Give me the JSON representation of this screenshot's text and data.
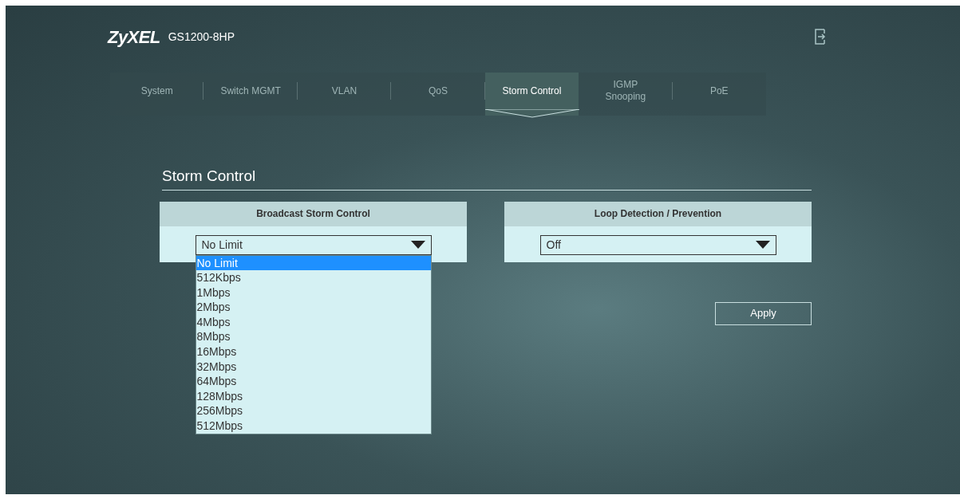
{
  "header": {
    "brand": "ZyXEL",
    "model": "GS1200-8HP"
  },
  "tabs": [
    {
      "label": "System",
      "selected": false
    },
    {
      "label": "Switch MGMT",
      "selected": false
    },
    {
      "label": "VLAN",
      "selected": false
    },
    {
      "label": "QoS",
      "selected": false
    },
    {
      "label": "Storm Control",
      "selected": true
    },
    {
      "label": "IGMP Snooping",
      "selected": false
    },
    {
      "label": "PoE",
      "selected": false
    }
  ],
  "section_title": "Storm Control",
  "panels": [
    {
      "header": "Broadcast Storm Control",
      "value": "No Limit",
      "options": [
        {
          "label": "No Limit",
          "selected": true
        },
        {
          "label": "512Kbps",
          "selected": false
        },
        {
          "label": "1Mbps",
          "selected": false
        },
        {
          "label": "2Mbps",
          "selected": false
        },
        {
          "label": "4Mbps",
          "selected": false
        },
        {
          "label": "8Mbps",
          "selected": false
        },
        {
          "label": "16Mbps",
          "selected": false
        },
        {
          "label": "32Mbps",
          "selected": false
        },
        {
          "label": "64Mbps",
          "selected": false
        },
        {
          "label": "128Mbps",
          "selected": false
        },
        {
          "label": "256Mbps",
          "selected": false
        },
        {
          "label": "512Mbps",
          "selected": false
        }
      ]
    },
    {
      "header": "Loop Detection / Prevention",
      "value": "Off"
    }
  ],
  "apply_button": "Apply"
}
